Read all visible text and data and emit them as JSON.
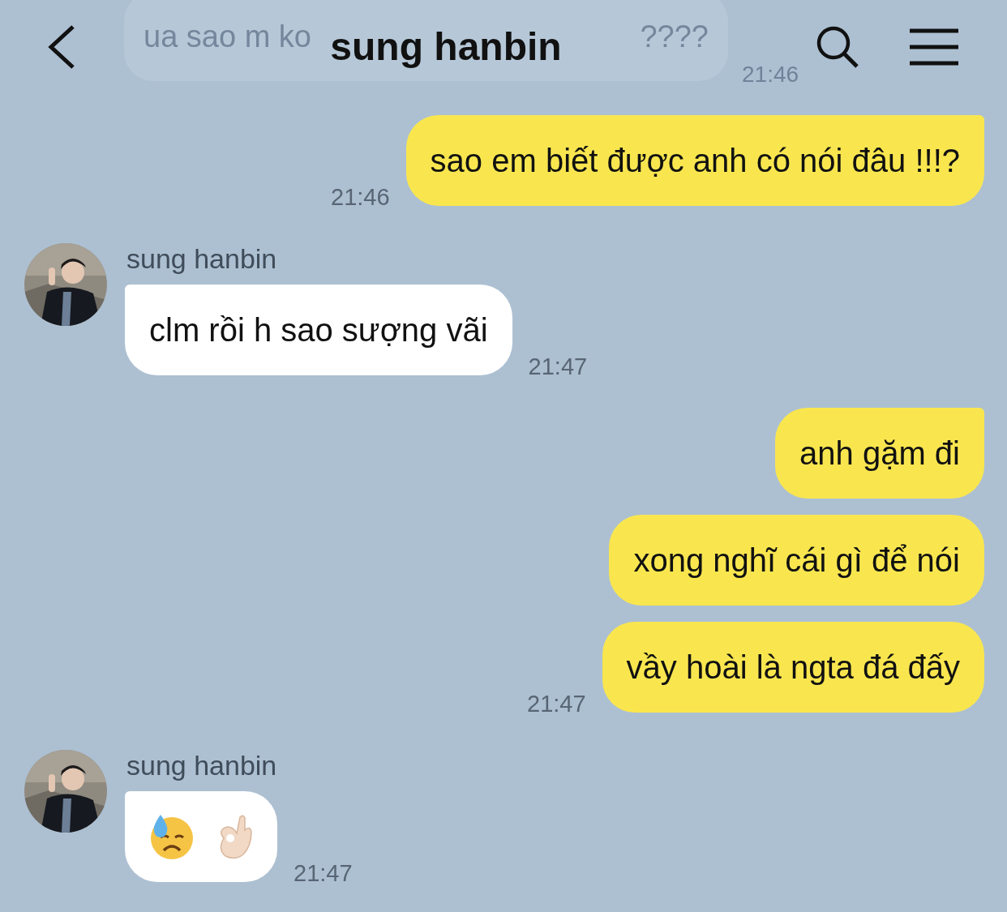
{
  "header": {
    "title": "sung hanbin",
    "behind": {
      "text_start": "ua sao m ko",
      "text_end": "????",
      "time": "21:46"
    }
  },
  "messages": [
    {
      "outgoing": true,
      "kind": "text",
      "text": "sao em biết được anh có nói đâu !!!?",
      "time": "21:46",
      "tail": true
    },
    {
      "outgoing": false,
      "name": "sung hanbin",
      "kind": "text",
      "text": "clm rồi h sao sượng vãi",
      "time": "21:47",
      "tail": true
    },
    {
      "outgoing": true,
      "kind": "text",
      "text": "anh gặm đi",
      "tail": true
    },
    {
      "outgoing": true,
      "kind": "text",
      "text": "xong nghĩ cái gì để nói",
      "tail": false
    },
    {
      "outgoing": true,
      "kind": "text",
      "text": "vầy hoài là ngta đá đấy",
      "time": "21:47",
      "tail": false
    },
    {
      "outgoing": false,
      "name": "sung hanbin",
      "kind": "emoji",
      "time": "21:47",
      "tail": true
    }
  ]
}
